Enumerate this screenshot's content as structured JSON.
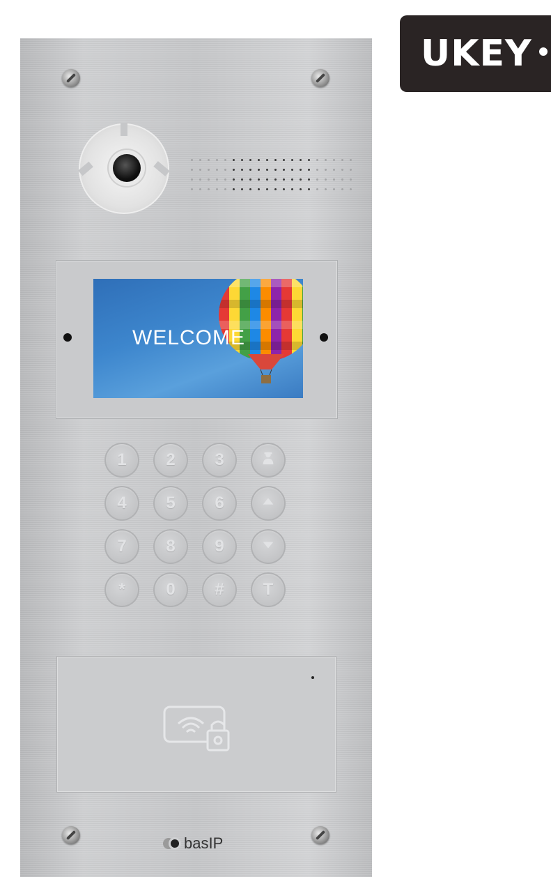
{
  "badge": {
    "text": "UKEY"
  },
  "panel": {
    "screen": {
      "greeting": "WELCOME"
    },
    "keypad": {
      "keys": [
        {
          "label": "1"
        },
        {
          "label": "2"
        },
        {
          "label": "3"
        },
        {
          "label": "",
          "icon": "concierge-icon"
        },
        {
          "label": "4"
        },
        {
          "label": "5"
        },
        {
          "label": "6"
        },
        {
          "label": "",
          "icon": "arrow-up-icon"
        },
        {
          "label": "7"
        },
        {
          "label": "8"
        },
        {
          "label": "9"
        },
        {
          "label": "",
          "icon": "arrow-down-icon"
        },
        {
          "label": "*"
        },
        {
          "label": "0"
        },
        {
          "label": "#"
        },
        {
          "label": "T"
        }
      ]
    },
    "card_reader": {
      "icon": "nfc-lock-icon"
    },
    "logo": {
      "text": "basIP"
    }
  },
  "colors": {
    "panel": "#c6c7c9",
    "badge": "#2a2424",
    "screen": "#3d86cd"
  }
}
